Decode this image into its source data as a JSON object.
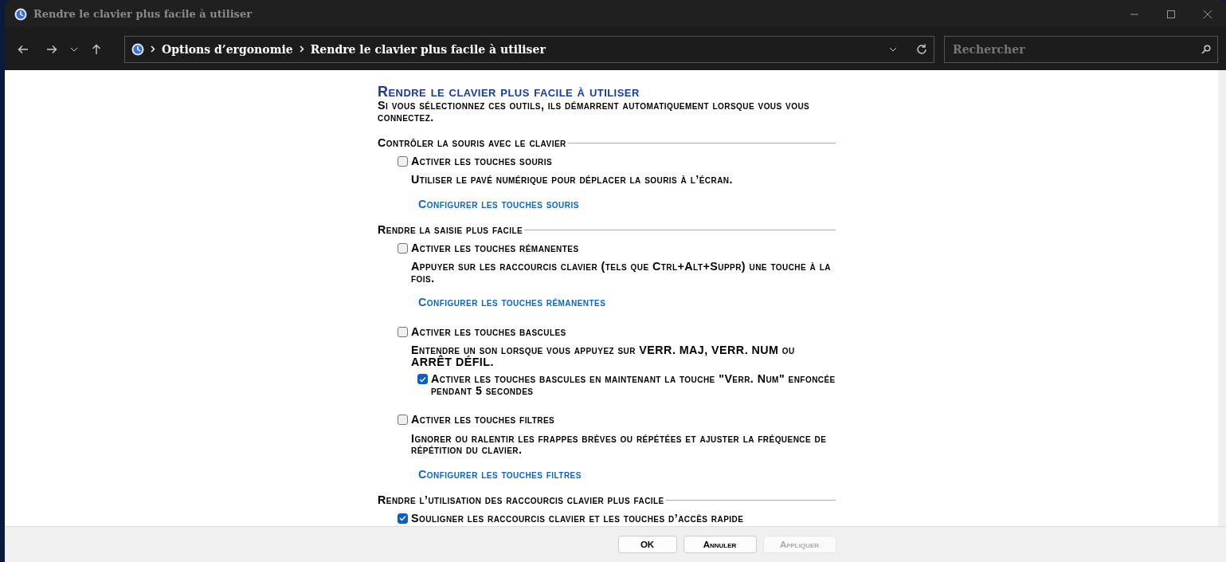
{
  "window": {
    "title": "Rendre le clavier plus facile à utiliser"
  },
  "address_bar": {
    "breadcrumbs": [
      "Options d’ergonomie",
      "Rendre le clavier plus facile à utiliser"
    ]
  },
  "search": {
    "placeholder": "Rechercher"
  },
  "page": {
    "title": "Rendre le clavier plus facile à utiliser",
    "intro": "Si vous sélectionnez ces outils, ils démarrent automatiquement lorsque vous vous connectez."
  },
  "sections": [
    {
      "heading": "Contrôler la souris avec le clavier",
      "items": [
        {
          "label": "Activer les touches souris",
          "checked": false,
          "description": "Utiliser le pavé numérique pour déplacer la souris à l’écran.",
          "link": "Configurer les touches souris"
        }
      ]
    },
    {
      "heading": "Rendre la saisie plus facile",
      "items": [
        {
          "label": "Activer les touches rémanentes",
          "checked": false,
          "description": "Appuyer sur les raccourcis clavier (tels que Ctrl+Alt+Suppr) une touche à la fois.",
          "link": "Configurer les touches rémanentes"
        },
        {
          "label": "Activer les touches bascules",
          "checked": false,
          "description": "Entendre un son lorsque vous appuyez sur VERR. MAJ, VERR. NUM ou ARRÊT DÉFIL.",
          "children": [
            {
              "label": "Activer les touches bascules en maintenant la touche \"Verr. Num\" enfoncée pendant 5 secondes",
              "checked": true
            }
          ]
        },
        {
          "label": "Activer les touches filtres",
          "checked": false,
          "description": "Ignorer ou ralentir les frappes brèves ou répétées et ajuster la fréquence de répétition du clavier.",
          "link": "Configurer les touches filtres"
        }
      ]
    },
    {
      "heading": "Rendre l’utilisation des raccourcis clavier plus facile",
      "items": [
        {
          "label": "Souligner les raccourcis clavier et les touches d’accès rapide",
          "checked": true
        }
      ]
    }
  ],
  "buttons": [
    {
      "label": "OK",
      "disabled": false
    },
    {
      "label": "Annuler",
      "disabled": false
    },
    {
      "label": "Appliquer",
      "disabled": true
    }
  ]
}
